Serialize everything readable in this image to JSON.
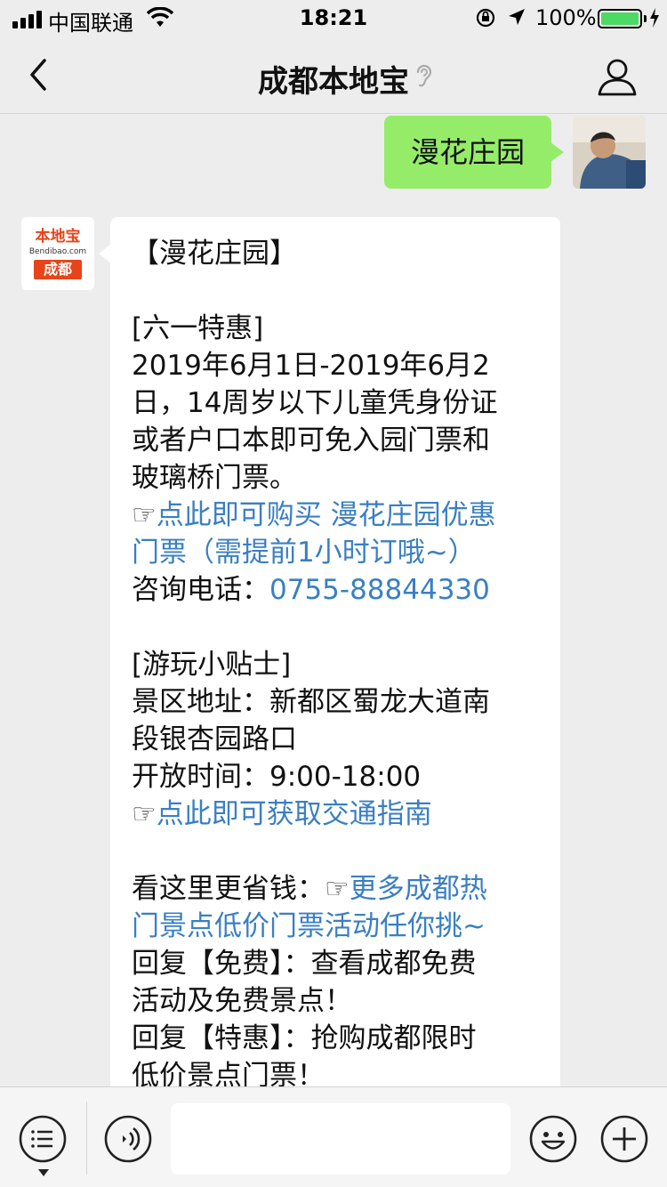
{
  "status": {
    "carrier": "中国联通",
    "time": "18:21",
    "battery_pct": "100%",
    "battery_color": "#4cd964"
  },
  "nav": {
    "title": "成都本地宝",
    "icons": [
      "back-arrow-icon",
      "ear-icon",
      "person-icon"
    ]
  },
  "sent_message": {
    "text": "漫花庄园",
    "bubble_color": "#95ec69"
  },
  "bot": {
    "logo_top": "本地宝",
    "logo_mid": "Bendibao.com",
    "logo_bottom": "成都",
    "logo_color": "#e8441a"
  },
  "reply": {
    "title": "【漫花庄园】",
    "s1_title": "[六一特惠]",
    "s1_l1": "2019年6月1日-2019年6月2",
    "s1_l2": "日，14周岁以下儿童凭身份证",
    "s1_l3": "或者户口本即可免入园门票和",
    "s1_l4": "玻璃桥门票。",
    "hand": "☞",
    "buy_link_l1": "点此即可购买 漫花庄园优惠",
    "buy_link_l2": "门票（需提前1小时订哦~）",
    "phone_label": "咨询电话：",
    "phone": "0755-88844330",
    "s2_title": "[游玩小贴士]",
    "addr_l1": "景区地址：新都区蜀龙大道南",
    "addr_l2": "段银杏园路口",
    "hours": "开放时间：9:00-18:00",
    "traffic_link": "点此即可获取交通指南",
    "save_label": "看这里更省钱：",
    "more_link_l1": "更多成都热",
    "more_link_l2": "门景点低价门票活动任你挑~",
    "reply1_l1": "回复【免费】：查看成都免费",
    "reply1_l2": "活动及免费景点！",
    "reply2_l1": "回复【特惠】：抢购成都限时",
    "reply2_l2": "低价景点门票！",
    "link_color": "#3a7fc2"
  },
  "input_bar": {
    "placeholder": "",
    "icons": [
      "menu-icon",
      "voice-icon",
      "emoji-icon",
      "plus-icon"
    ]
  }
}
